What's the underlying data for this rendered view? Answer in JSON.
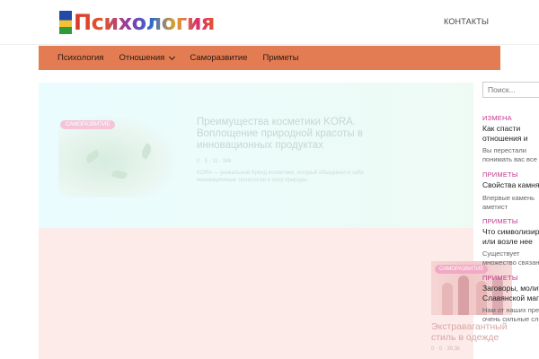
{
  "header": {
    "logo_text": "Психология",
    "contacts_label": "КОНТАКТЫ"
  },
  "nav": {
    "items": [
      "Психология",
      "Отношения",
      "Саморазвитие",
      "Приметы"
    ]
  },
  "featured": [
    {
      "tag": "САМОРАЗВИТИЕ",
      "title": "Преимущества косметики KORA. Воплощение природной красоты в инновационных продуктах",
      "meta": "0 · 5 · 11 · 34k",
      "desc": "KORA — уникальный бренд косметики, который объединил в себе инновационные технологии и силу природы."
    },
    {
      "tag": "САМОРАЗВИТИЕ",
      "title": "Экстравагантный стиль в одежде",
      "meta": "0 · 0 · 39,3k"
    }
  ],
  "sidebar": {
    "search_placeholder": "Поиск...",
    "posts": [
      {
        "category": "ИЗМЕНА",
        "title": "Как спасти отношения и сохранить брак?",
        "desc": "Вы перестали понимать вас все меньше"
      },
      {
        "category": "ПРИМЕТЫ",
        "title": "Свойства камня аметист",
        "desc": "Впервые камень аметист использовался"
      },
      {
        "category": "ПРИМЕТЫ",
        "title": "Что символизирует или возле нее",
        "desc": "Существует множество связанных с домом"
      },
      {
        "category": "ПРИМЕТЫ",
        "title": "Заговоры, молитвы Славянской магии",
        "desc": "Нам от наших предков очень сильные слова"
      }
    ]
  }
}
